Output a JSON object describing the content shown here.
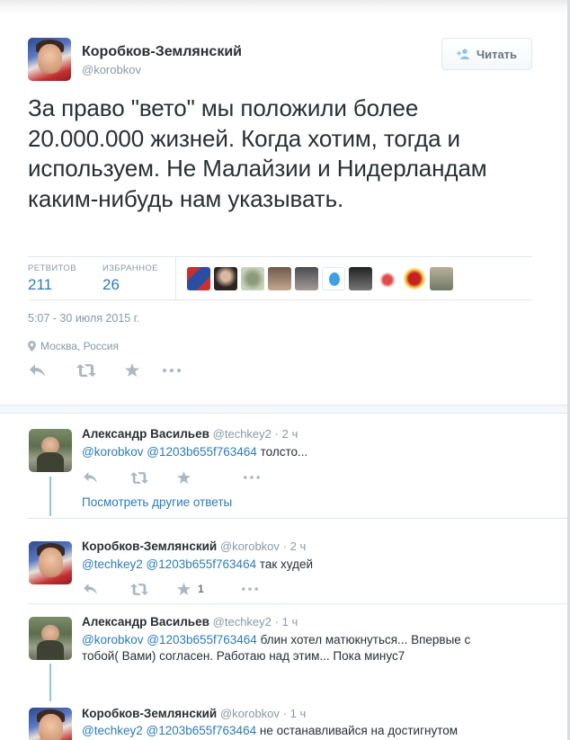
{
  "main_tweet": {
    "name": "Коробков-Землянский",
    "handle": "@korobkov",
    "follow_label": "Читать",
    "text": "За право \"вето\" мы положили более 20.000.000 жизней. Когда хотим, тогда и используем. Не Малайзии и Нидерландам каким-нибудь нам указывать.",
    "retweets_label": "РЕТВИТОВ",
    "retweets_count": "211",
    "favorites_label": "ИЗБРАННОЕ",
    "favorites_count": "26",
    "timestamp": "5:07 - 30 июля 2015 г.",
    "location": "Москва, Россия"
  },
  "replies": [
    {
      "name": "Александр Васильев",
      "handle": "@techkey2",
      "time": "· 2 ч",
      "mention1": "@korobkov",
      "mention2": "@1203b655f763464",
      "text": "толсто..."
    },
    {
      "name": "Коробков-Землянский",
      "handle": "@korobkov",
      "time": "· 2 ч",
      "mention1": "@techkey2",
      "mention2": "@1203b655f763464",
      "text": "так худей",
      "fav_count": "1"
    },
    {
      "name": "Александр Васильев",
      "handle": "@techkey2",
      "time": "· 1 ч",
      "mention1": "@korobkov",
      "mention2": "@1203b655f763464",
      "text": "блин хотел матюкнуться... Впервые с тобой( Вами) согласен. Работаю над этим... Пока минус7"
    },
    {
      "name": "Коробков-Землянский",
      "handle": "@korobkov",
      "time": "· 1 ч",
      "mention1": "@techkey2",
      "mention2": "@1203b655f763464",
      "text": "не останавливайся на достигнутом"
    }
  ],
  "more_replies_label": "Посмотреть другие ответы",
  "icons": [
    "follow-icon",
    "location-pin-icon",
    "reply-icon",
    "retweet-icon",
    "favorite-icon",
    "more-icon"
  ],
  "colors": {
    "link": "#2b7bb9",
    "muted": "#8899a6",
    "text": "#292f33",
    "thread": "#8ec5ee"
  }
}
